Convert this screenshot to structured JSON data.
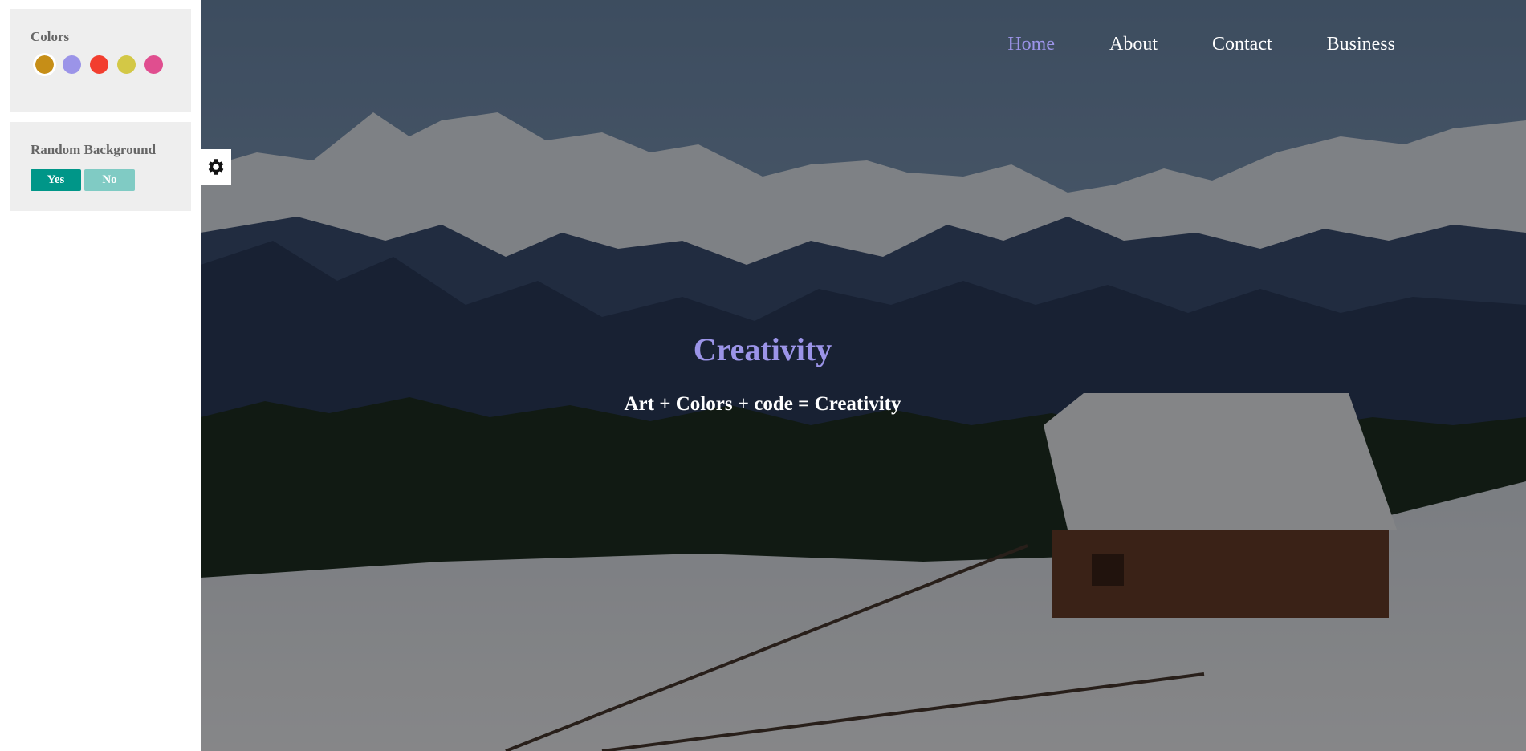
{
  "settings": {
    "colors_title": "Colors",
    "colors": [
      {
        "name": "gold",
        "hex": "#c68e17",
        "active": true
      },
      {
        "name": "lavender",
        "hex": "#9b94e8",
        "active": false
      },
      {
        "name": "red",
        "hex": "#f23e2f",
        "active": false
      },
      {
        "name": "yellow",
        "hex": "#d3c846",
        "active": false
      },
      {
        "name": "pink",
        "hex": "#e04e8f",
        "active": false
      }
    ],
    "random_bg_title": "Random Background",
    "yes_label": "Yes",
    "no_label": "No",
    "yes_color": "#009688",
    "no_color": "#80cbc4",
    "gear_icon": "gear-icon"
  },
  "nav": {
    "items": [
      "Home",
      "About",
      "Contact",
      "Business"
    ],
    "active_index": 0,
    "active_color": "#9b94e8"
  },
  "hero": {
    "title": "Creativity",
    "subtitle": "Art + Colors + code = Creativity",
    "title_color": "#9b94e8"
  }
}
